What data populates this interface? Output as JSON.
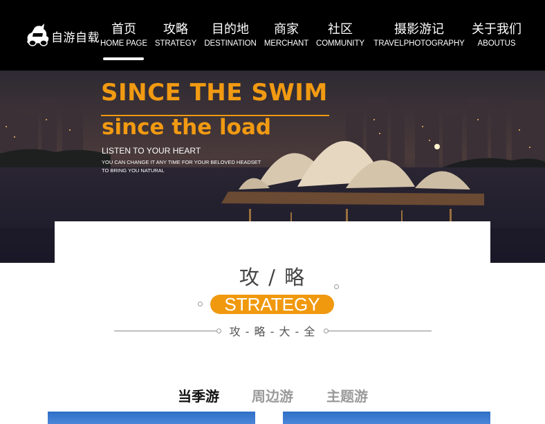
{
  "brand": {
    "name": "自游自载"
  },
  "nav": {
    "items": [
      {
        "cn": "首页",
        "en": "HOME PAGE"
      },
      {
        "cn": "攻略",
        "en": "STRATEGY"
      },
      {
        "cn": "目的地",
        "en": "DESTINATION"
      },
      {
        "cn": "商家",
        "en": "MERCHANT"
      },
      {
        "cn": "社区",
        "en": "COMMUNITY"
      },
      {
        "cn": "摄影游记",
        "en": "TRAVELPHOTOGRAPHY"
      },
      {
        "cn": "关于我们",
        "en": "ABOUTUS"
      }
    ],
    "active": "HOME PAGE"
  },
  "banner": {
    "headline": "SINCE THE SWIM",
    "subheadline": "since the load",
    "tagline": "LISTEN TO YOUR HEART",
    "line1": "YOU CAN CHANGE IT ANY TIME FOR YOUR BELOVED HEADSET",
    "line2": "TO BRING YOU NATURAL"
  },
  "section": {
    "title": "攻 / 略",
    "pill": "STRATEGY",
    "subtitle": "攻 - 略 - 大 - 全"
  },
  "tabs": [
    {
      "label": "当季游",
      "active": true
    },
    {
      "label": "周边游",
      "active": false
    },
    {
      "label": "主题游",
      "active": false
    }
  ],
  "colors": {
    "accent": "#f0990f",
    "nav_bg": "#000000"
  }
}
